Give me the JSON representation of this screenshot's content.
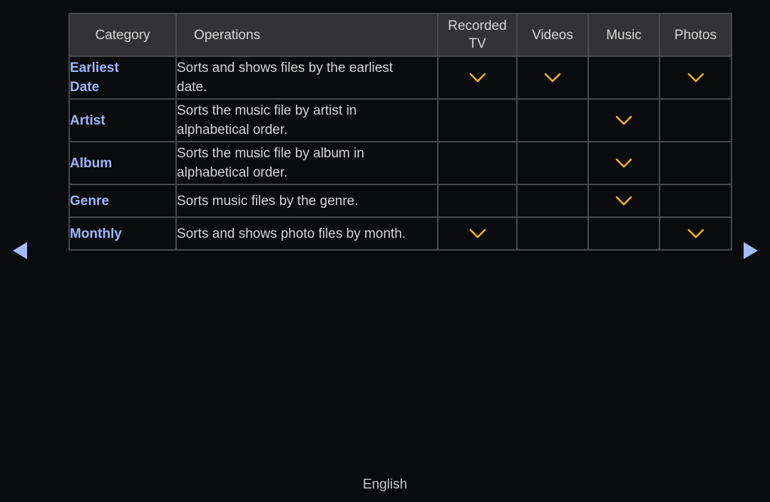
{
  "table": {
    "headers": {
      "category": "Category",
      "operations": "Operations",
      "recorded_tv": "Recorded TV",
      "videos": "Videos",
      "music": "Music",
      "photos": "Photos"
    },
    "rows": [
      {
        "category": "Earliest Date",
        "operation": "Sorts and shows files by the earliest date.",
        "recorded_tv": true,
        "videos": true,
        "music": false,
        "photos": true
      },
      {
        "category": "Artist",
        "operation": "Sorts the music file by artist in alphabetical order.",
        "recorded_tv": false,
        "videos": false,
        "music": true,
        "photos": false
      },
      {
        "category": "Album",
        "operation": "Sorts the music file by album in alphabetical order.",
        "recorded_tv": false,
        "videos": false,
        "music": true,
        "photos": false
      },
      {
        "category": "Genre",
        "operation": "Sorts music files by the genre.",
        "recorded_tv": false,
        "videos": false,
        "music": true,
        "photos": false
      },
      {
        "category": "Monthly",
        "operation": "Sorts and shows photo files by month.",
        "recorded_tv": true,
        "videos": false,
        "music": false,
        "photos": true
      }
    ],
    "check_icon": "checkmark-chevron-icon",
    "check_color": "#f0b41c"
  },
  "nav": {
    "prev_icon": "left-triangle-icon",
    "next_icon": "right-triangle-icon",
    "arrow_color": "#a4bcff"
  },
  "footer": {
    "language": "English"
  }
}
